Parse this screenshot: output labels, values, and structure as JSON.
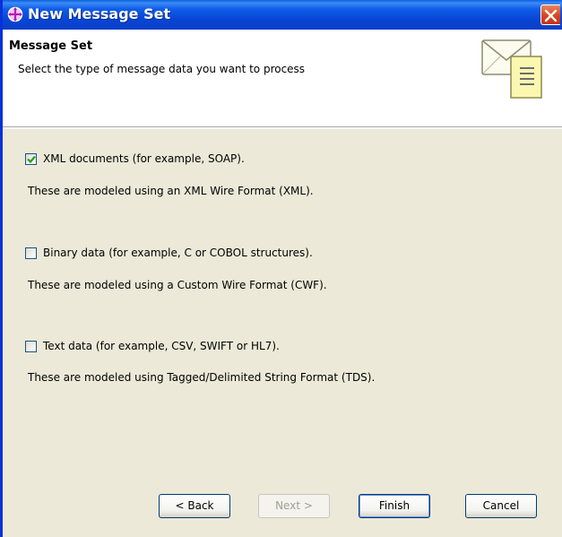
{
  "window": {
    "title": "New Message Set",
    "close_icon": "close-icon",
    "app_icon": "message-set-icon"
  },
  "header": {
    "title": "Message Set",
    "description": "Select the type of message data you want to process",
    "graphic_icon": "envelope-document-icon"
  },
  "options": [
    {
      "checked": true,
      "label": "XML documents (for example, SOAP).",
      "description": "These are modeled using an XML Wire Format (XML)."
    },
    {
      "checked": false,
      "label": "Binary data (for example, C or COBOL structures).",
      "description": "These are modeled using a Custom Wire Format (CWF)."
    },
    {
      "checked": false,
      "label": "Text data (for example, CSV, SWIFT or HL7).",
      "description": "These are modeled using Tagged/Delimited String Format (TDS)."
    }
  ],
  "buttons": {
    "back": "< Back",
    "next": "Next >",
    "finish": "Finish",
    "cancel": "Cancel"
  },
  "colors": {
    "titlebar": "#0a3fc7",
    "close_button": "#d9441c",
    "dialog_background": "#ece9d8",
    "header_background": "#ffffff"
  }
}
